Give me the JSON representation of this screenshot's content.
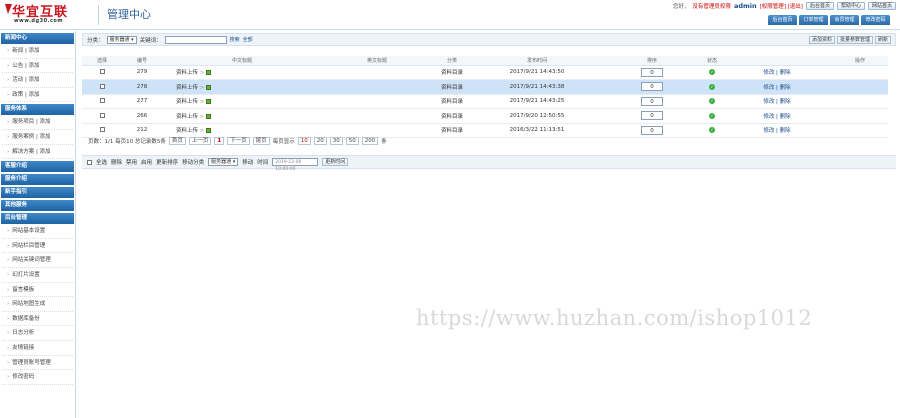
{
  "brand": {
    "logo_text": "华宜互联",
    "logo_url": "www.dg30.com",
    "title": "管理中心"
  },
  "topbar": {
    "greeting": "您好，",
    "warning": "没有管理员权限",
    "username": "admin",
    "user_note": "[权限管理] [退出]",
    "buttons": [
      "后台首页",
      "帮助中心",
      "网站首页"
    ]
  },
  "subnav": [
    "后台首页",
    "订单管理",
    "会员管理",
    "修改密码"
  ],
  "sidebar": {
    "sections": [
      {
        "title": "新闻中心",
        "items": [
          "新闻 | 添加",
          "公告 | 添加",
          "活动 | 添加",
          "政策 | 添加"
        ]
      },
      {
        "title": "服务体系",
        "items": [
          "服务项目 | 添加",
          "服务案例 | 添加",
          "解决方案 | 添加"
        ]
      },
      {
        "title": "客服介绍",
        "items": []
      },
      {
        "title": "服务介绍",
        "items": []
      },
      {
        "title": "新手指引",
        "items": []
      },
      {
        "title": "其他服务",
        "items": []
      },
      {
        "title": "后台管理",
        "items": [
          "网站基本设置",
          "网站栏目管理",
          "网站关键词管理",
          "幻灯片设置",
          "留言模板",
          "网站地图生成",
          "数据库备份",
          "日志分析",
          "友情链接",
          "管理员账号管理",
          "修改密码"
        ]
      }
    ]
  },
  "filter": {
    "category_label": "分类：",
    "category_value": "服务器通",
    "keyword_label": "关键词：",
    "keyword_value": "",
    "search": "搜索",
    "all": "全部",
    "right_buttons": [
      "添加资料",
      "批量参数管理",
      "刷新"
    ]
  },
  "table": {
    "headers": [
      "选择",
      "编号",
      "中文标题",
      "英文标题",
      "分类",
      "发布时间",
      "排序",
      "状态",
      "操作"
    ],
    "rows": [
      {
        "id": "279",
        "cn_title": "资料上传",
        "category": "资料目录",
        "time": "2017/9/21 14:43:50",
        "order": "0",
        "ops": "修改 | 删除",
        "selected": false
      },
      {
        "id": "278",
        "cn_title": "资料上传",
        "category": "资料目录",
        "time": "2017/9/21 14:43:38",
        "order": "0",
        "ops": "修改 | 删除",
        "selected": true
      },
      {
        "id": "277",
        "cn_title": "资料上传",
        "category": "资料目录",
        "time": "2017/9/21 14:43:25",
        "order": "0",
        "ops": "修改 | 删除",
        "selected": false
      },
      {
        "id": "266",
        "cn_title": "资料上传",
        "category": "资料目录",
        "time": "2017/9/20 12:50:55",
        "order": "0",
        "ops": "修改 | 删除",
        "selected": false
      },
      {
        "id": "212",
        "cn_title": "资料上传",
        "category": "资料目录",
        "time": "2016/3/22 11:13:51",
        "order": "0",
        "ops": "修改 | 删除",
        "selected": false
      }
    ]
  },
  "pager": {
    "info": "页数：1/1 每页10 总记录数5条",
    "first": "首页",
    "prev": "上一页",
    "current": "1",
    "next": "下一页",
    "last": "尾页",
    "per_page_label": "每页显示",
    "per_page_options": [
      "10",
      "20",
      "30",
      "50",
      "200"
    ],
    "unit": "条"
  },
  "actions": {
    "select_all": "全选",
    "items": [
      "删除",
      "禁用",
      "启用",
      "更新排序",
      "移动分类"
    ],
    "move_select": "服务器通",
    "move": "移动",
    "time_label": "时间",
    "time_value": "2019-12-06 10:00:00",
    "update_time": "更新时间"
  },
  "watermark": "https://www.huzhan.com/ishop1012"
}
